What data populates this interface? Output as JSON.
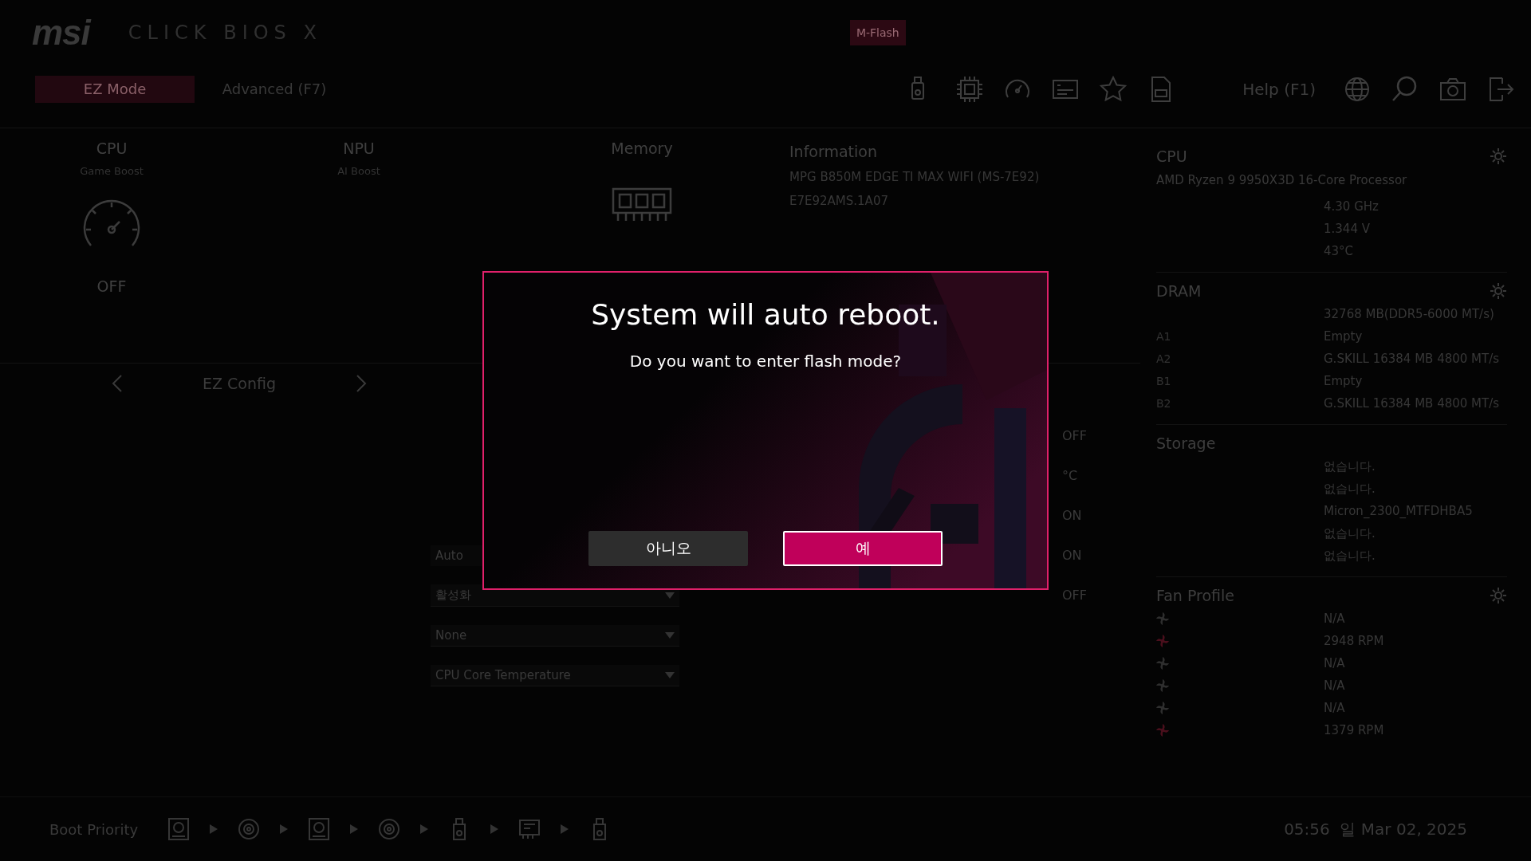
{
  "header": {
    "logo": "msi",
    "product": "CLICK BIOS X",
    "badge": "M-Flash",
    "help": "Help (F1)",
    "tabs": [
      {
        "label": "EZ Mode",
        "selected": true
      },
      {
        "label": "Advanced (F7)",
        "selected": false
      }
    ]
  },
  "overview": [
    {
      "kind": "gauge",
      "title": "CPU",
      "subtitle": "Game Boost",
      "state": "OFF"
    },
    {
      "kind": "plain",
      "title": "NPU",
      "subtitle": "AI Boost"
    },
    {
      "kind": "memory",
      "title": "Memory"
    }
  ],
  "information": {
    "title": "Information",
    "lines": [
      "MPG B850M EDGE TI MAX WIFI (MS-7E92)",
      "E7E92AMS.1A07"
    ]
  },
  "ez_config": {
    "title": "EZ Config",
    "rows": [
      {
        "kind": "blank"
      },
      {
        "kind": "blank"
      },
      {
        "kind": "blank"
      },
      {
        "kind": "field",
        "value": "Auto"
      },
      {
        "kind": "dropdown",
        "value": "활성화"
      },
      {
        "kind": "dropdown",
        "value": "None"
      },
      {
        "kind": "dropdown",
        "value": "CPU Core Temperature"
      }
    ],
    "switches": [
      "OFF",
      "°C",
      "ON",
      "ON",
      "OFF"
    ]
  },
  "cpu": {
    "title": "CPU",
    "model": "AMD Ryzen 9 9950X3D 16-Core Processor",
    "values": [
      "4.30 GHz",
      "1.344 V",
      "43°C"
    ]
  },
  "dram": {
    "title": "DRAM",
    "rows": [
      {
        "label": "",
        "value": "32768 MB(DDR5-6000 MT/s)"
      },
      {
        "label": "A1",
        "value": "Empty"
      },
      {
        "label": "A2",
        "value": "G.SKILL 16384 MB 4800 MT/s"
      },
      {
        "label": "B1",
        "value": "Empty"
      },
      {
        "label": "B2",
        "value": "G.SKILL 16384 MB 4800 MT/s"
      }
    ]
  },
  "storage": {
    "title": "Storage",
    "values": [
      "없습니다.",
      "없습니다.",
      "Micron_2300_MTFDHBA5",
      "없습니다.",
      "없습니다."
    ]
  },
  "fans": {
    "title": "Fan Profile",
    "rows": [
      {
        "value": "N/A",
        "active": false
      },
      {
        "value": "2948 RPM",
        "active": true
      },
      {
        "value": "N/A",
        "active": false
      },
      {
        "value": "N/A",
        "active": false
      },
      {
        "value": "N/A",
        "active": false
      },
      {
        "value": "1379 RPM",
        "active": true
      }
    ]
  },
  "boot_priority": {
    "label": "Boot Priority",
    "devices": [
      {
        "kind": "hdd"
      },
      {
        "kind": "disc"
      },
      {
        "kind": "hdd"
      },
      {
        "kind": "disc"
      },
      {
        "kind": "usb"
      },
      {
        "kind": "card"
      },
      {
        "kind": "usb"
      }
    ]
  },
  "clock": "05:56  일 Mar 02, 2025",
  "dialog": {
    "title": "System will auto reboot.",
    "message": "Do you want to enter flash mode?",
    "buttons": [
      {
        "label": "아니오",
        "selected": false
      },
      {
        "label": "예",
        "selected": true
      }
    ]
  }
}
